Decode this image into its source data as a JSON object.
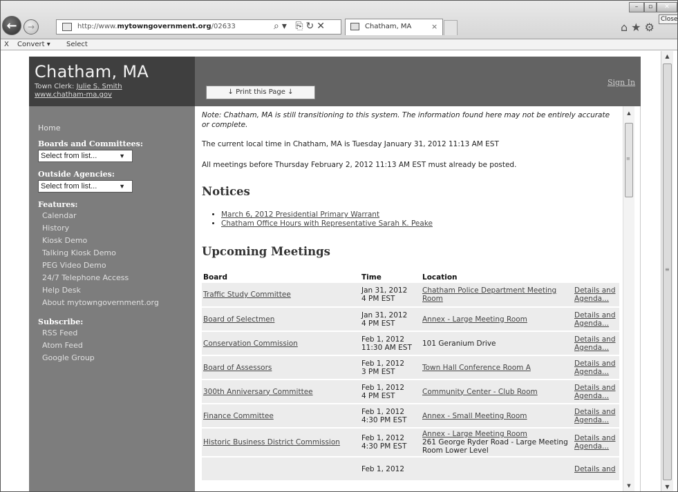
{
  "browser": {
    "url_prefix": "http://www.",
    "url_bold": "mytowngovernment.org",
    "url_suffix": "/02633",
    "tab_title": "Chatham, MA",
    "tab_close": "×",
    "close_tooltip": "Close",
    "back_glyph": "←",
    "forward_glyph": "→",
    "addr_tools": "⌕▾ ⎘↻✕",
    "right_icons": "⌂★⚙",
    "min_glyph": "–",
    "max_glyph": "▫",
    "close_glyph": "✕"
  },
  "commandbar": {
    "x": "X",
    "convert": "Convert ▾",
    "select": "Select"
  },
  "header": {
    "title": "Chatham, MA",
    "clerk_prefix": "Town Clerk: ",
    "clerk_name": "Julie S. Smith",
    "site_url": "www.chatham-ma.gov",
    "print_label": "↓ Print this Page ↓",
    "sign_in": "Sign In"
  },
  "sidebar": {
    "home": "Home",
    "boards_heading": "Boards and Committees:",
    "boards_select": "Select from list...",
    "outside_heading": "Outside Agencies:",
    "outside_select": "Select from list...",
    "features_heading": "Features:",
    "features": [
      "Calendar",
      "History",
      "Kiosk Demo",
      "Talking Kiosk Demo",
      "PEG Video Demo",
      "24/7 Telephone Access",
      "Help Desk",
      "About mytowngovernment.org"
    ],
    "subscribe_heading": "Subscribe:",
    "subscribe": [
      "RSS Feed",
      "Atom Feed",
      "Google Group"
    ]
  },
  "main": {
    "note": "Note: Chatham, MA is still transitioning to this system. The information found here may not be entirely accurate or complete.",
    "local_time": "The current local time in Chatham, MA is Tuesday January 31, 2012 11:13 AM EST",
    "posted": "All meetings before Thursday February 2, 2012 11:13 AM EST must already be posted.",
    "notices_heading": "Notices",
    "notices": [
      "March 6, 2012 Presidential Primary Warrant",
      "Chatham Office Hours with Representative Sarah K. Peake"
    ],
    "upcoming_heading": "Upcoming Meetings",
    "columns": [
      "Board",
      "Time",
      "Location",
      ""
    ],
    "meetings": [
      {
        "board": "Traffic Study Committee",
        "time1": "Jan 31, 2012",
        "time2": "4 PM EST",
        "loc1": "Chatham Police Department Meeting Room",
        "loc2": "",
        "loc_link": true,
        "details1": "Details and",
        "details2": "Agenda..."
      },
      {
        "board": "Board of Selectmen",
        "time1": "Jan 31, 2012",
        "time2": "4 PM EST",
        "loc1": "Annex - Large Meeting Room",
        "loc2": "",
        "loc_link": true,
        "details1": "Details and",
        "details2": "Agenda..."
      },
      {
        "board": "Conservation Commission",
        "time1": "Feb 1, 2012",
        "time2": "11:30 AM EST",
        "loc1": "101 Geranium Drive",
        "loc2": "",
        "loc_link": false,
        "details1": "Details and",
        "details2": "Agenda..."
      },
      {
        "board": "Board of Assessors",
        "time1": "Feb 1, 2012",
        "time2": "3 PM EST",
        "loc1": "Town Hall Conference Room A",
        "loc2": "",
        "loc_link": true,
        "details1": "Details and",
        "details2": "Agenda..."
      },
      {
        "board": "300th Anniversary Committee",
        "time1": "Feb 1, 2012",
        "time2": "4 PM EST",
        "loc1": "Community Center - Club Room",
        "loc2": "",
        "loc_link": true,
        "details1": "Details and",
        "details2": "Agenda..."
      },
      {
        "board": "Finance Committee",
        "time1": "Feb 1, 2012",
        "time2": "4:30 PM EST",
        "loc1": "Annex - Small Meeting Room",
        "loc2": "",
        "loc_link": true,
        "details1": "Details and",
        "details2": "Agenda..."
      },
      {
        "board": "Historic Business District Commission",
        "time1": "Feb 1, 2012",
        "time2": "4:30 PM EST",
        "loc1": "Annex - Large Meeting Room",
        "loc2": "261 George Ryder Road - Large Meeting Room Lower Level",
        "loc_link": true,
        "details1": "Details and",
        "details2": "Agenda..."
      },
      {
        "board": "",
        "time1": "Feb 1, 2012",
        "time2": "",
        "loc1": "",
        "loc2": "",
        "loc_link": false,
        "details1": "Details and",
        "details2": ""
      }
    ]
  }
}
